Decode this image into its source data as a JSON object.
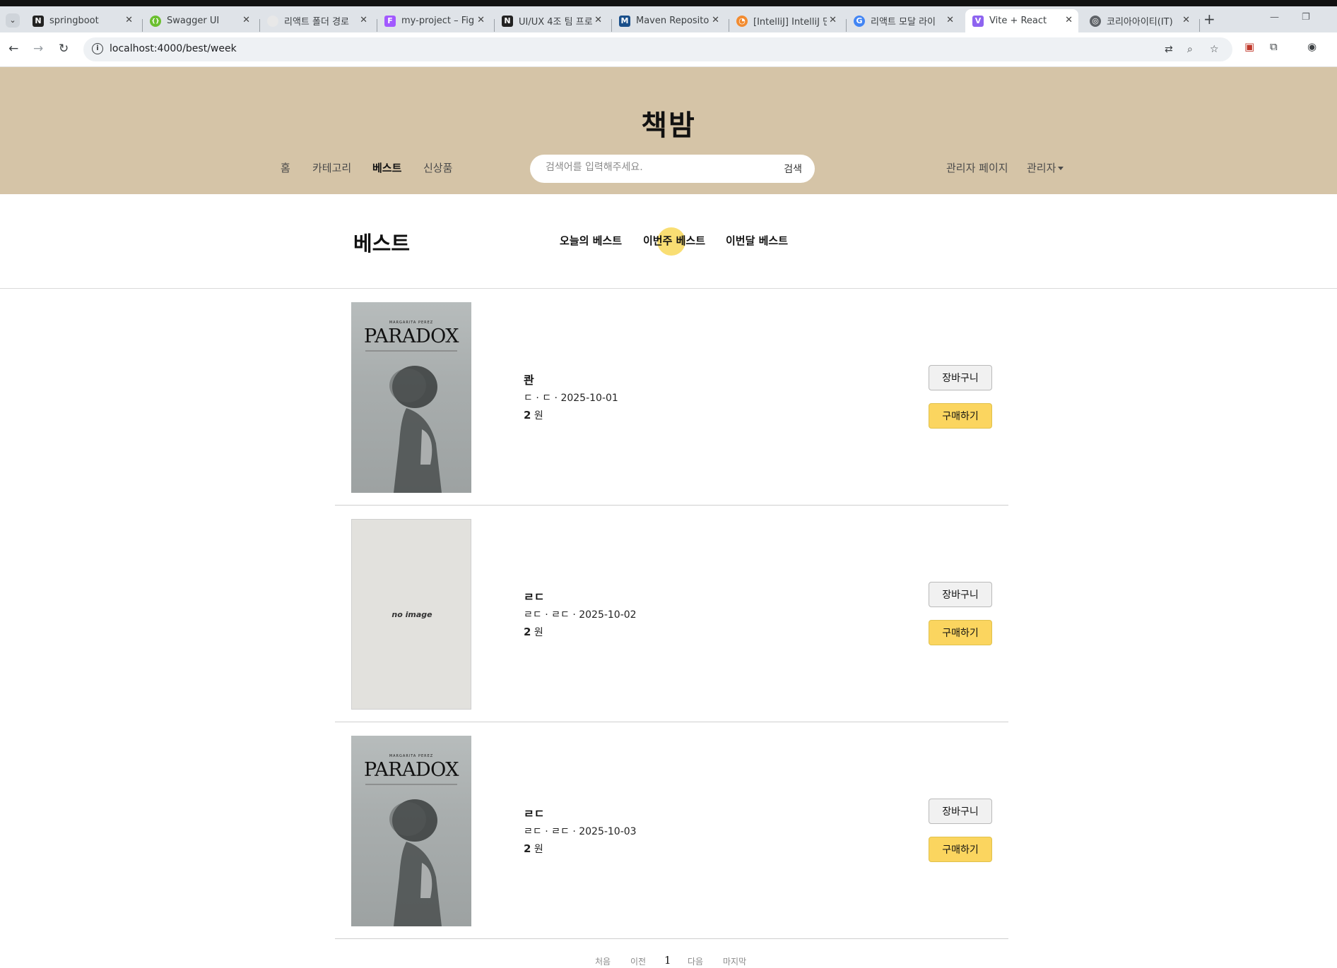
{
  "browser": {
    "tabs": [
      {
        "title": "springboot",
        "fav_color": "#222222",
        "fav_glyph": "N"
      },
      {
        "title": "Swagger UI",
        "fav_color": "#6bbf2f",
        "fav_glyph": "{}"
      },
      {
        "title": "리액트 폴더 경로",
        "fav_color": "#e8e8e8",
        "fav_glyph": ""
      },
      {
        "title": "my-project – Figma",
        "fav_color": "#a259ff",
        "fav_glyph": "F"
      },
      {
        "title": "UI/UX 4조 팀 프로",
        "fav_color": "#222222",
        "fav_glyph": "N"
      },
      {
        "title": "Maven Repository",
        "fav_color": "#1a4f8a",
        "fav_glyph": "M"
      },
      {
        "title": "[IntelliJ] IntelliJ 단",
        "fav_color": "#f28b30",
        "fav_glyph": "◔"
      },
      {
        "title": "리액트 모달 라이",
        "fav_color": "#4285f4",
        "fav_glyph": "G"
      },
      {
        "title": "Vite + React",
        "fav_color": "#8e64f0",
        "fav_glyph": "V"
      },
      {
        "title": "코리아아이티(IT)",
        "fav_color": "#5f6368",
        "fav_glyph": "◎"
      }
    ],
    "active_tab_index": 8,
    "url": "localhost:4000/best/week"
  },
  "site": {
    "logo": "책밤",
    "nav": {
      "home": "홈",
      "category": "카테고리",
      "best": "베스트",
      "new": "신상품"
    },
    "search": {
      "placeholder": "검색어를 입력해주세요.",
      "button": "검색"
    },
    "admin_page": "관리자 페이지",
    "admin_menu": "관리자"
  },
  "best": {
    "title": "베스트",
    "tabs": {
      "today": "오늘의 베스트",
      "week": "이번주 베스트",
      "month": "이번달 베스트"
    },
    "active_tab": "week"
  },
  "items": [
    {
      "title": "콴",
      "meta": "ㄷ · ㄷ · 2025-10-01",
      "price_num": "2",
      "price_unit": "원",
      "cover": "paradox",
      "cover_author": "MARGARITA PEREZ",
      "cover_title": "PARADOX",
      "cart": "장바구니",
      "buy": "구매하기"
    },
    {
      "title": "ㄹㄷ",
      "meta": "ㄹㄷ · ㄹㄷ · 2025-10-02",
      "price_num": "2",
      "price_unit": "원",
      "cover": "none",
      "cover_label": "no image",
      "cart": "장바구니",
      "buy": "구매하기"
    },
    {
      "title": "ㄹㄷ",
      "meta": "ㄹㄷ · ㄹㄷ · 2025-10-03",
      "price_num": "2",
      "price_unit": "원",
      "cover": "paradox",
      "cover_author": "MARGARITA PEREZ",
      "cover_title": "PARADOX",
      "cart": "장바구니",
      "buy": "구매하기"
    }
  ],
  "pagination": {
    "first": "처음",
    "prev": "이전",
    "current": "1",
    "next": "다음",
    "last": "마지막"
  },
  "colors": {
    "header_bg": "#d5c4a7",
    "buy_button": "#fbd55f",
    "active_tab_highlight": "#f8d85a"
  }
}
